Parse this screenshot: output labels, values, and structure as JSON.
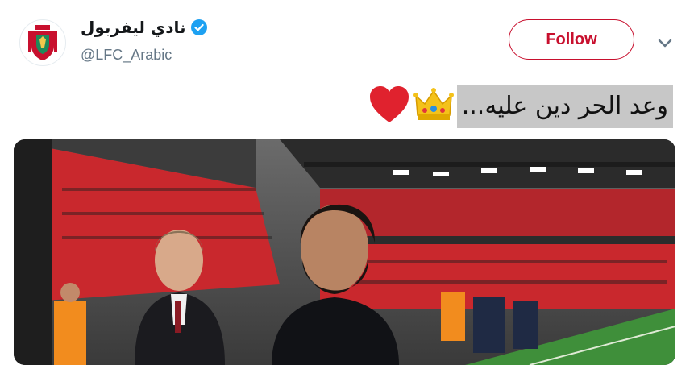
{
  "account": {
    "display_name": "نادي ليفربول",
    "handle": "@LFC_Arabic",
    "verified": true
  },
  "actions": {
    "follow_label": "Follow"
  },
  "tweet": {
    "text": "وعد الحر دين عليه...",
    "emojis": [
      "crown-emoji",
      "red-heart-emoji"
    ]
  },
  "colors": {
    "brand": "#c8102e",
    "verified": "#1da1f2",
    "handle": "#657786",
    "pitch": "#3f8f3a",
    "stand": "#c9282d"
  },
  "icons": [
    "lfc-crest-icon",
    "verified-badge-icon",
    "chevron-down-icon"
  ]
}
